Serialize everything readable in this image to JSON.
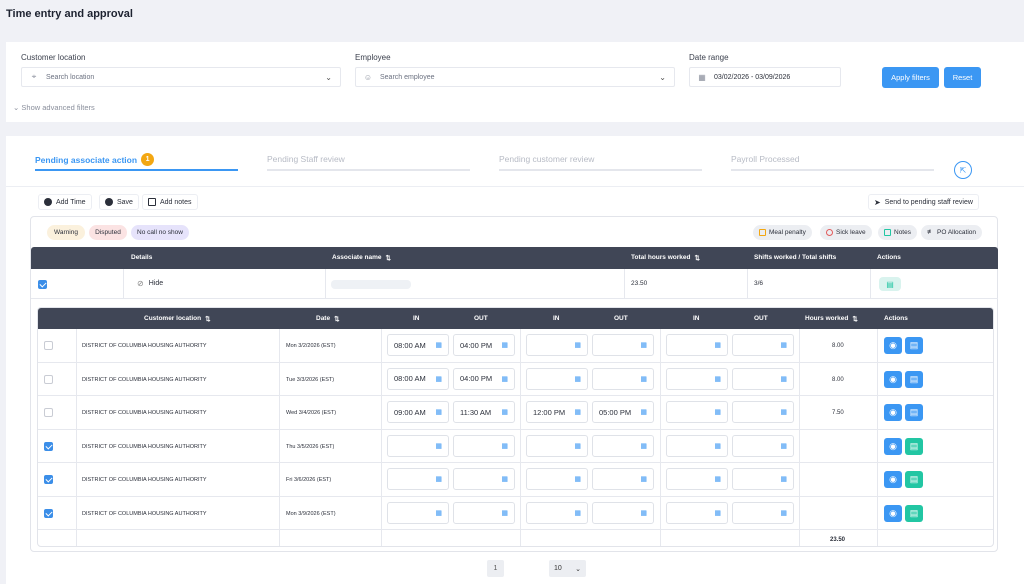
{
  "page": {
    "title": "Time entry and approval"
  },
  "filters": {
    "customer_location": {
      "label": "Customer location",
      "placeholder": "Search location"
    },
    "employee": {
      "label": "Employee",
      "placeholder": "Search employee"
    },
    "date_range": {
      "label": "Date range",
      "value": "03/02/2026 - 03/09/2026"
    },
    "apply_label": "Apply filters",
    "reset_label": "Reset",
    "advanced_label": "Show advanced filters"
  },
  "tabs": [
    {
      "label": "Pending associate action",
      "badge": "1",
      "active": true
    },
    {
      "label": "Pending Staff review"
    },
    {
      "label": "Pending customer review"
    },
    {
      "label": "Payroll Processed"
    }
  ],
  "toolbar": {
    "add_time": "Add Time",
    "save": "Save",
    "add_notes": "Add notes",
    "send": "Send to pending staff review"
  },
  "status_pills": [
    {
      "label": "Warning",
      "color": "#fbf1dd"
    },
    {
      "label": "Disputed",
      "color": "#fbe3e3"
    },
    {
      "label": "No call no show",
      "color": "#e6e3fb"
    }
  ],
  "legend": [
    {
      "label": "Meal penalty",
      "icon": "meal-icon",
      "color": "#f3a712"
    },
    {
      "label": "Sick leave",
      "icon": "sick-icon",
      "color": "#e25b5b"
    },
    {
      "label": "Notes",
      "icon": "notes-icon",
      "color": "#22c6a3"
    },
    {
      "label": "PO Allocation",
      "icon": "po-icon",
      "color": "#404656"
    }
  ],
  "associate_table": {
    "headers": {
      "details": "Details",
      "name": "Associate name",
      "total_hours": "Total hours worked",
      "shifts": "Shifts worked / Total shifts",
      "actions": "Actions"
    },
    "row": {
      "hide_label": "Hide",
      "total_hours": "23.50",
      "shifts": "3/6"
    }
  },
  "shift_table": {
    "headers": {
      "location": "Customer location",
      "date": "Date",
      "in": "IN",
      "out": "OUT",
      "hours": "Hours worked",
      "actions": "Actions"
    },
    "rows": [
      {
        "checked": false,
        "location": "DISTRICT OF COLUMBIA HOUSING AUTHORITY",
        "date": "Mon 3/2/2026 (EST)",
        "in1": "08:00 AM",
        "out1": "04:00 PM",
        "in2": "",
        "out2": "",
        "in3": "",
        "out3": "",
        "hours": "8.00"
      },
      {
        "checked": false,
        "location": "DISTRICT OF COLUMBIA HOUSING AUTHORITY",
        "date": "Tue 3/3/2026 (EST)",
        "in1": "08:00 AM",
        "out1": "04:00 PM",
        "in2": "",
        "out2": "",
        "in3": "",
        "out3": "",
        "hours": "8.00"
      },
      {
        "checked": false,
        "location": "DISTRICT OF COLUMBIA HOUSING AUTHORITY",
        "date": "Wed 3/4/2026 (EST)",
        "in1": "09:00 AM",
        "out1": "11:30 AM",
        "in2": "12:00 PM",
        "out2": "05:00 PM",
        "in3": "",
        "out3": "",
        "hours": "7.50"
      },
      {
        "checked": true,
        "location": "DISTRICT OF COLUMBIA HOUSING AUTHORITY",
        "date": "Thu 3/5/2026 (EST)",
        "in1": "",
        "out1": "",
        "in2": "",
        "out2": "",
        "in3": "",
        "out3": "",
        "hours": ""
      },
      {
        "checked": true,
        "location": "DISTRICT OF COLUMBIA HOUSING AUTHORITY",
        "date": "Fri 3/6/2026 (EST)",
        "in1": "",
        "out1": "",
        "in2": "",
        "out2": "",
        "in3": "",
        "out3": "",
        "hours": ""
      },
      {
        "checked": true,
        "location": "DISTRICT OF COLUMBIA HOUSING AUTHORITY",
        "date": "Mon 3/9/2026 (EST)",
        "in1": "",
        "out1": "",
        "in2": "",
        "out2": "",
        "in3": "",
        "out3": "",
        "hours": ""
      }
    ],
    "total_hours": "23.50"
  },
  "pagination": {
    "page": "1",
    "per_page": "10"
  }
}
